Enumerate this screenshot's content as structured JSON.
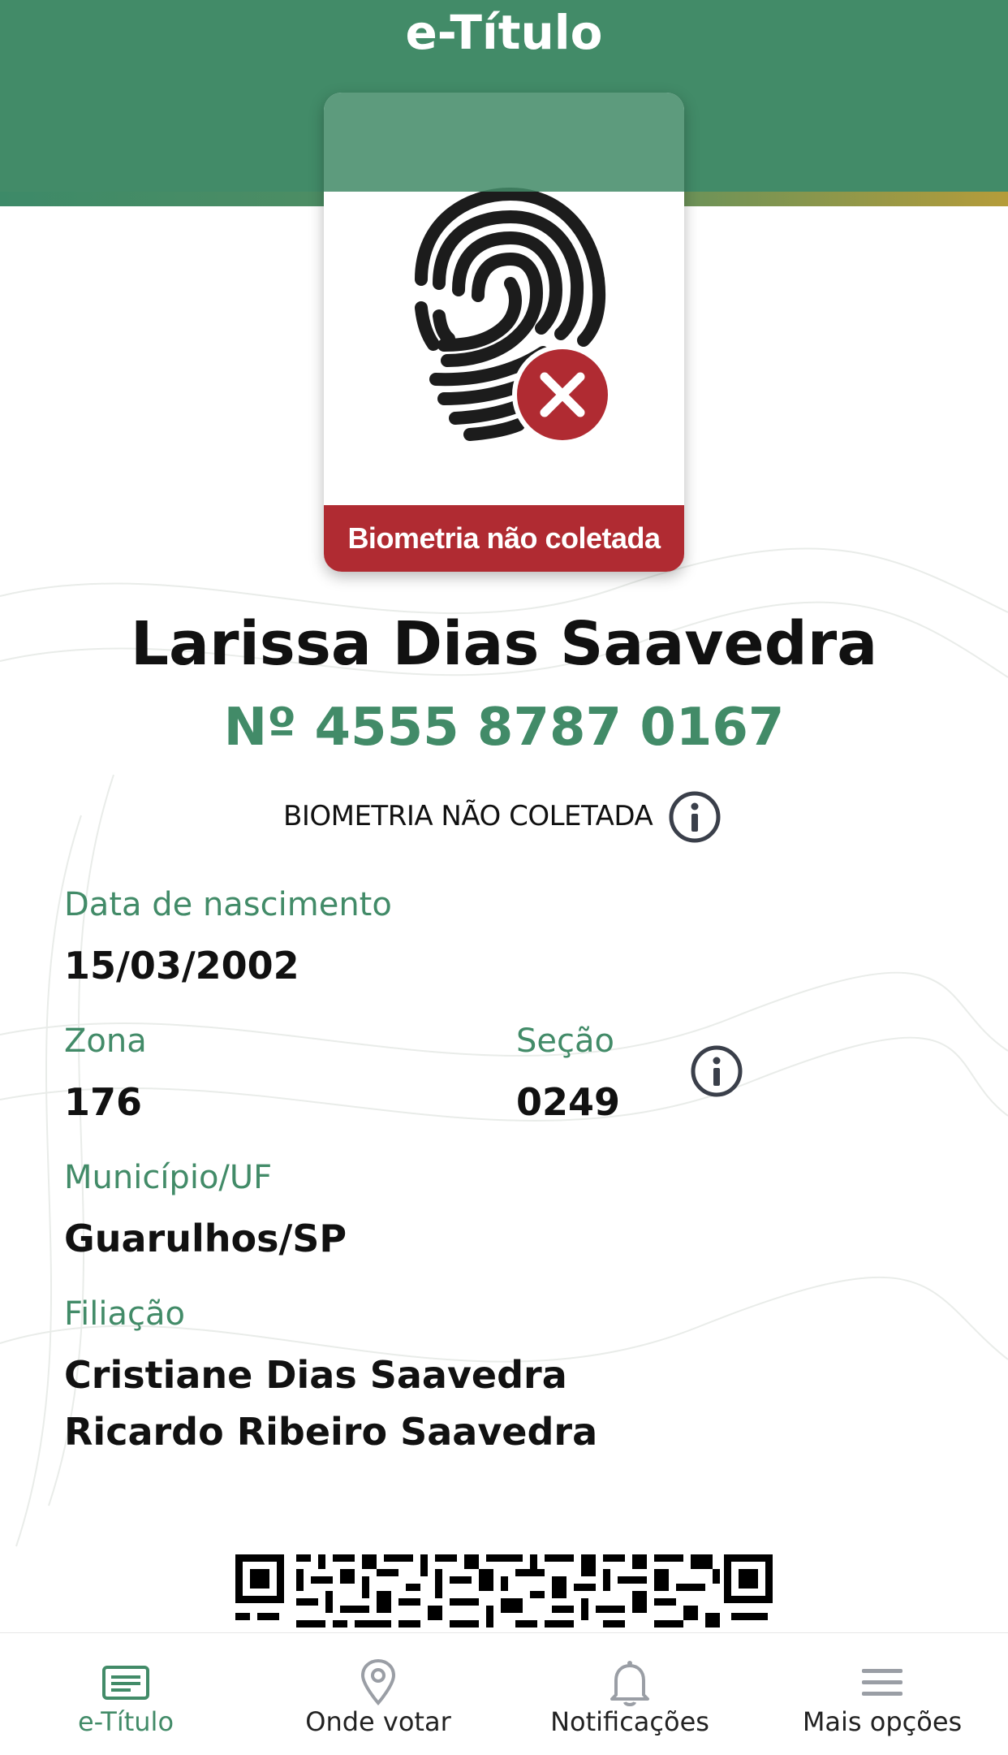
{
  "header": {
    "title": "e-Título"
  },
  "card": {
    "status_label": "Biometria não coletada"
  },
  "voter": {
    "name": "Larissa Dias Saavedra",
    "number": "Nº 4555 8787 0167",
    "biometry_status": "BIOMETRIA NÃO COLETADA"
  },
  "fields": {
    "birth_label": "Data de nascimento",
    "birth_value": "15/03/2002",
    "zone_label": "Zona",
    "zone_value": "176",
    "section_label": "Seção",
    "section_value": "0249",
    "city_label": "Município/UF",
    "city_value": "Guarulhos/SP",
    "parents_label": "Filiação",
    "parent1": "Cristiane Dias Saavedra",
    "parent2": "Ricardo Ribeiro Saavedra"
  },
  "nav": {
    "items": [
      {
        "label": "e-Título",
        "icon": "id-card-icon",
        "active": true
      },
      {
        "label": "Onde votar",
        "icon": "map-pin-icon",
        "active": false
      },
      {
        "label": "Notificações",
        "icon": "bell-icon",
        "active": false
      },
      {
        "label": "Mais opções",
        "icon": "menu-icon",
        "active": false
      }
    ]
  },
  "colors": {
    "primary": "#428b68",
    "alert": "#b02b32",
    "text": "#111111"
  }
}
